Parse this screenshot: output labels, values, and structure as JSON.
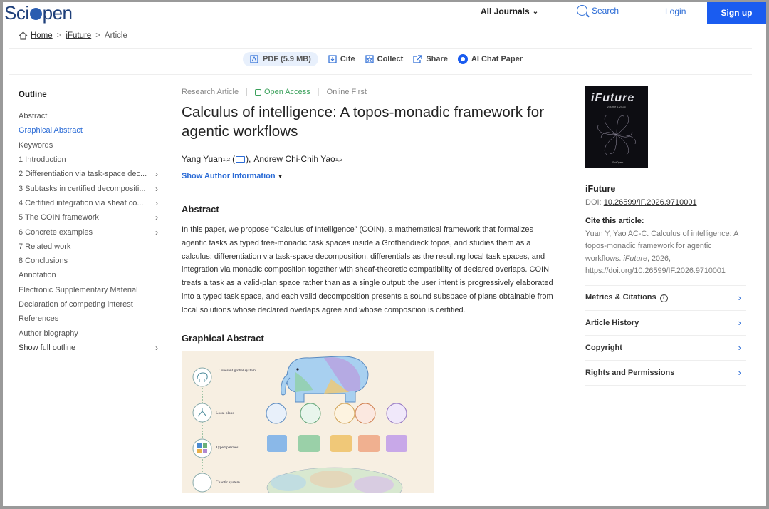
{
  "nav": {
    "logo_left": "Sci",
    "logo_right": "pen",
    "journals": "All Journals",
    "search": "Search",
    "login": "Login",
    "signup": "Sign up"
  },
  "breadcrumb": {
    "home": "Home",
    "journal": "iFuture",
    "current": "Article",
    "sep": ">"
  },
  "toolbar": {
    "pdf": "PDF (5.9 MB)",
    "cite": "Cite",
    "collect": "Collect",
    "share": "Share",
    "ai": "AI Chat Paper"
  },
  "outline": {
    "title": "Outline",
    "items": [
      {
        "label": "Abstract",
        "arrow": ""
      },
      {
        "label": "Graphical Abstract",
        "arrow": ""
      },
      {
        "label": "Keywords",
        "arrow": ""
      },
      {
        "label": "1 Introduction",
        "arrow": ""
      },
      {
        "label": "2 Differentiation via task-space dec...",
        "arrow": "›"
      },
      {
        "label": "3 Subtasks in certified decompositi...",
        "arrow": "›"
      },
      {
        "label": "4 Certified integration via sheaf co...",
        "arrow": "›"
      },
      {
        "label": "5 The COIN framework",
        "arrow": "›"
      },
      {
        "label": "6 Concrete examples",
        "arrow": "›"
      },
      {
        "label": "7 Related work",
        "arrow": ""
      },
      {
        "label": "8 Conclusions",
        "arrow": ""
      },
      {
        "label": "Annotation",
        "arrow": ""
      },
      {
        "label": "Electronic Supplementary Material",
        "arrow": ""
      },
      {
        "label": "Declaration of competing interest",
        "arrow": ""
      },
      {
        "label": "References",
        "arrow": ""
      },
      {
        "label": "Author biography",
        "arrow": ""
      },
      {
        "label": "Show full outline",
        "arrow": "›"
      }
    ]
  },
  "article": {
    "type": "Research Article",
    "access": "Open Access",
    "status": "Online First",
    "title": "Calculus of intelligence: A topos-monadic framework for agentic workflows",
    "author1": "Yang Yuan",
    "author1_sup": "1,2",
    "author1_paren_open": "(",
    "author1_paren_close": "),",
    "author2": "Andrew Chi-Chih Yao",
    "author2_sup": "1,2",
    "show_author": "Show Author Information",
    "abstract_heading": "Abstract",
    "abstract": "In this paper, we propose “Calculus of Intelligence” (COIN), a mathematical framework that formalizes agentic tasks as typed free-monadic task spaces inside a Grothendieck topos, and studies them as a calculus: differentiation via task-space decomposition, differentials as the resulting local task spaces, and integration via monadic composition together with sheaf-theoretic compatibility of declared overlaps. COIN treats a task as a valid-plan space rather than as a single output: the user intent is progressively elaborated into a typed task space, and each valid decomposition presents a sound subspace of plans obtainable from local solutions whose declared overlaps agree and whose composition is certified.",
    "ga_heading": "Graphical Abstract",
    "ga_labels": {
      "coherent": "Coherent global system",
      "local": "Local plans",
      "typed": "Typed patches",
      "chaotic": "Chaotic system"
    }
  },
  "sidebar": {
    "cover_title": "iFuture",
    "cover_sub": "Volume 1 2026",
    "cover_foot": "SciOpen",
    "journal": "iFuture",
    "doi_label": "DOI:",
    "doi": "10.26599/IF.2026.9710001",
    "cite_heading": "Cite this article:",
    "cite_pre": "Yuan Y, Yao AC-C. Calculus of intelligence: A topos-monadic framework for agentic workflows. ",
    "cite_journal": "iFuture",
    "cite_post": ", 2026, https://doi.org/10.26599/IF.2026.9710001",
    "sections": [
      {
        "label": "Metrics & Citations",
        "info": true
      },
      {
        "label": "Article History",
        "info": false
      },
      {
        "label": "Copyright",
        "info": false
      },
      {
        "label": "Rights and Permissions",
        "info": false
      }
    ],
    "arrow": "›"
  },
  "colors": {
    "accent": "#2a6bd6",
    "signup_bg": "#1a5cf0",
    "open_access": "#3aa05a"
  }
}
